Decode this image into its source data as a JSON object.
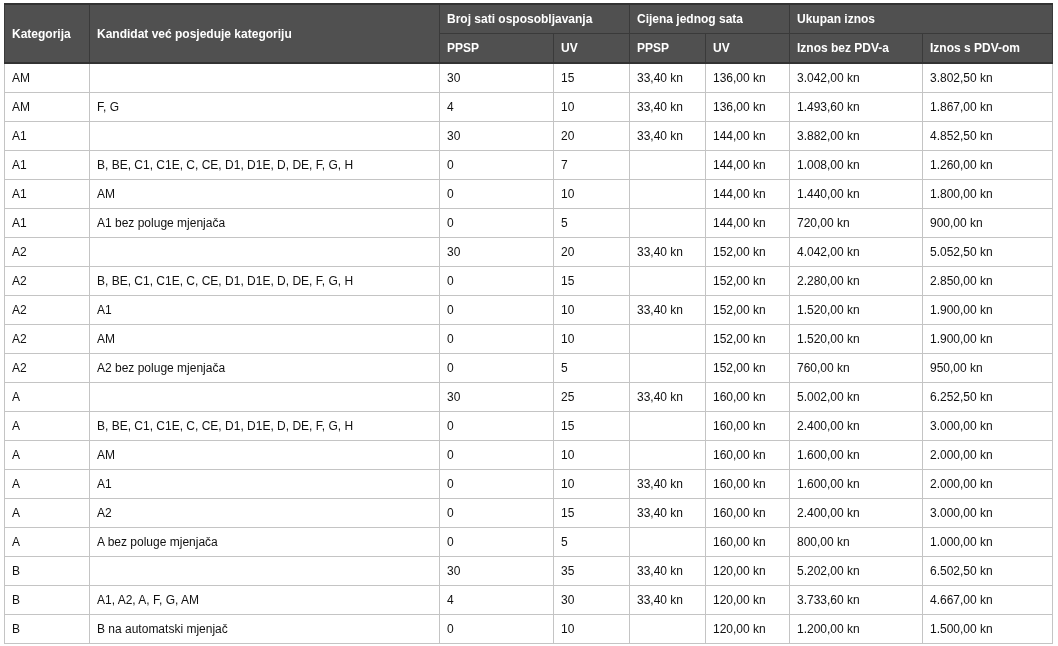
{
  "table": {
    "header_rows": [
      [
        "Kategorija",
        "Kandidat već posjeduje kategoriju",
        "Broj sati osposobljavanja",
        "Cijena jednog sata",
        "Ukupan iznos"
      ],
      [
        "PPSP",
        "UV",
        "PPSP",
        "UV",
        "Iznos bez PDV-a",
        "Iznos s PDV-om"
      ]
    ],
    "rows": [
      [
        "AM",
        null,
        "30",
        "15",
        "33,40 kn",
        "136,00 kn",
        "3.042,00 kn",
        "3.802,50 kn"
      ],
      [
        "AM",
        "F, G",
        "4",
        "10",
        "33,40 kn",
        "136,00 kn",
        "1.493,60 kn",
        "1.867,00 kn"
      ],
      [
        "A1",
        null,
        "30",
        "20",
        "33,40 kn",
        "144,00 kn",
        "3.882,00 kn",
        "4.852,50 kn"
      ],
      [
        "A1",
        "B, BE, C1, C1E, C, CE, D1, D1E, D, DE, F, G, H",
        "0",
        "7",
        null,
        "144,00 kn",
        "1.008,00 kn",
        "1.260,00 kn"
      ],
      [
        "A1",
        "AM",
        "0",
        "10",
        null,
        "144,00 kn",
        "1.440,00 kn",
        "1.800,00 kn"
      ],
      [
        "A1",
        "A1 bez poluge mjenjača",
        "0",
        "5",
        null,
        "144,00 kn",
        "720,00 kn",
        "900,00 kn"
      ],
      [
        "A2",
        null,
        "30",
        "20",
        "33,40 kn",
        "152,00 kn",
        "4.042,00 kn",
        "5.052,50 kn"
      ],
      [
        "A2",
        "B, BE, C1, C1E, C, CE, D1, D1E, D, DE, F, G, H",
        "0",
        "15",
        null,
        "152,00 kn",
        "2.280,00 kn",
        "2.850,00 kn"
      ],
      [
        "A2",
        "A1",
        "0",
        "10",
        "33,40 kn",
        "152,00 kn",
        "1.520,00 kn",
        "1.900,00 kn"
      ],
      [
        "A2",
        "AM",
        "0",
        "10",
        null,
        "152,00 kn",
        "1.520,00 kn",
        "1.900,00 kn"
      ],
      [
        "A2",
        "A2 bez poluge mjenjača",
        "0",
        "5",
        null,
        "152,00 kn",
        "760,00 kn",
        "950,00 kn"
      ],
      [
        "A",
        null,
        "30",
        "25",
        "33,40 kn",
        "160,00 kn",
        "5.002,00 kn",
        "6.252,50 kn"
      ],
      [
        "A",
        "B, BE, C1, C1E, C, CE, D1, D1E, D, DE, F, G, H",
        "0",
        "15",
        null,
        "160,00 kn",
        "2.400,00 kn",
        "3.000,00 kn"
      ],
      [
        "A",
        "AM",
        "0",
        "10",
        null,
        "160,00 kn",
        "1.600,00 kn",
        "2.000,00 kn"
      ],
      [
        "A",
        "A1",
        "0",
        "10",
        "33,40 kn",
        "160,00 kn",
        "1.600,00 kn",
        "2.000,00 kn"
      ],
      [
        "A",
        "A2",
        "0",
        "15",
        "33,40 kn",
        "160,00 kn",
        "2.400,00 kn",
        "3.000,00 kn"
      ],
      [
        "A",
        "A bez poluge mjenjača",
        "0",
        "5",
        null,
        "160,00 kn",
        "800,00 kn",
        "1.000,00 kn"
      ],
      [
        "B",
        null,
        "30",
        "35",
        "33,40 kn",
        "120,00 kn",
        "5.202,00 kn",
        "6.502,50 kn"
      ],
      [
        "B",
        "A1, A2, A, F, G, AM",
        "4",
        "30",
        "33,40 kn",
        "120,00 kn",
        "3.733,60 kn",
        "4.667,00 kn"
      ],
      [
        "B",
        "B na automatski mjenjač",
        "0",
        "10",
        null,
        "120,00 kn",
        "1.200,00 kn",
        "1.500,00 kn"
      ]
    ]
  }
}
